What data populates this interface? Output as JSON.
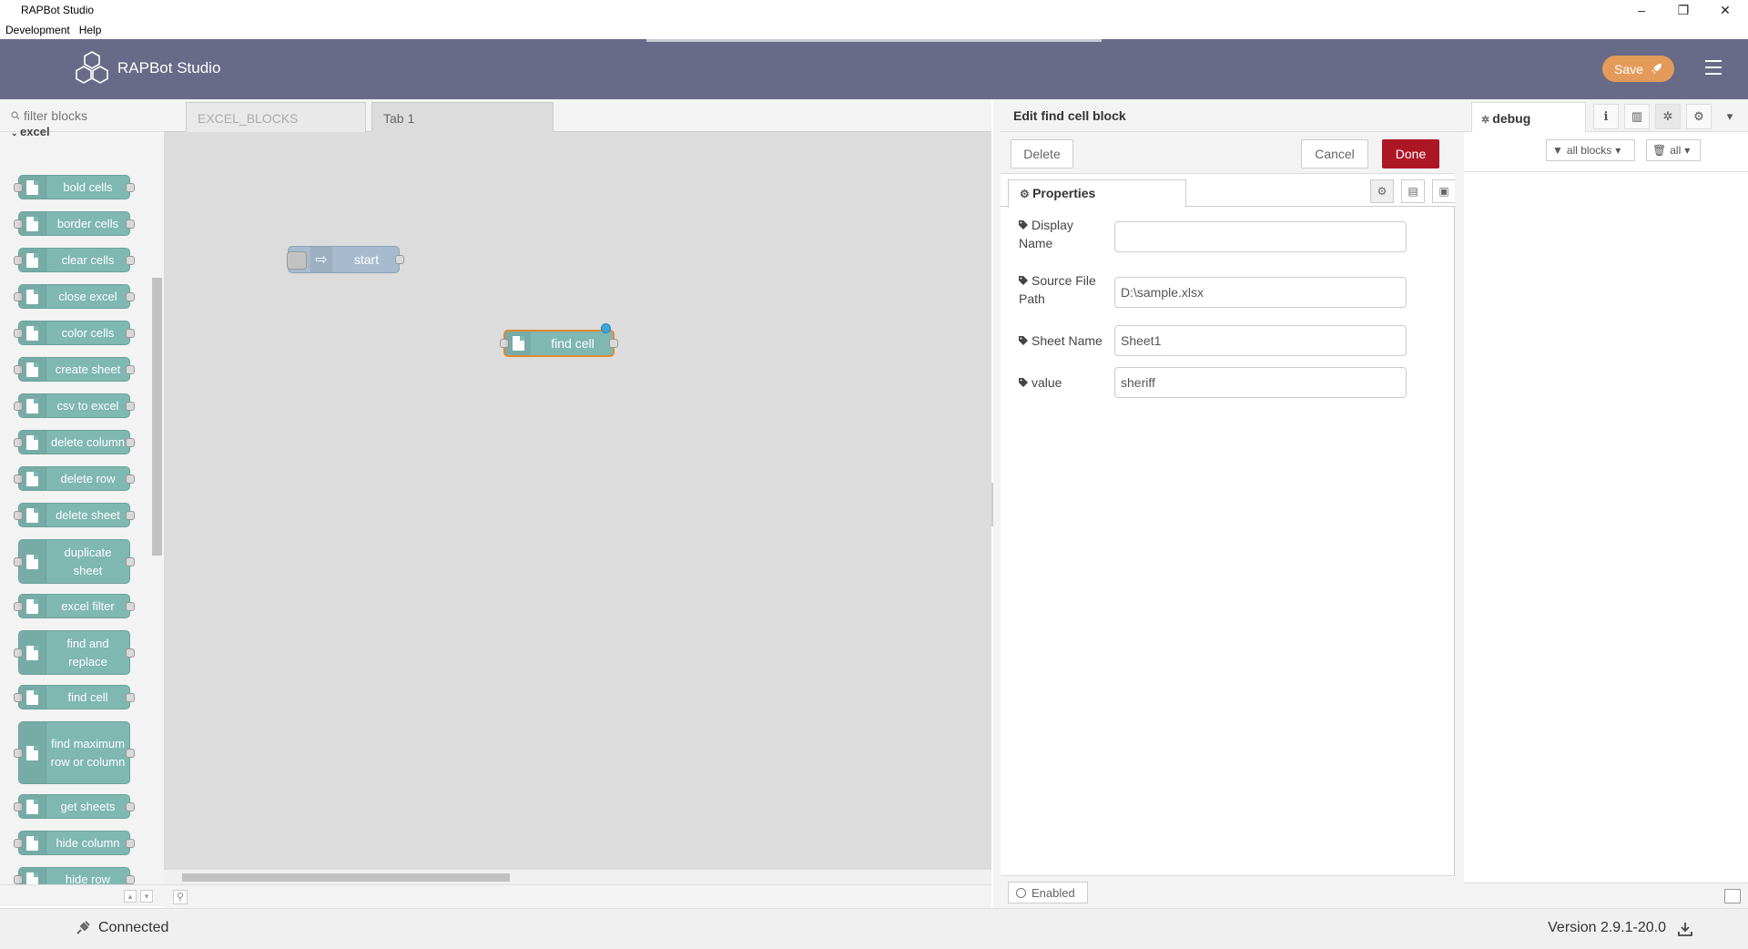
{
  "window": {
    "title": "RAPBot Studio",
    "menus": [
      "Development",
      "Help"
    ],
    "controls": [
      "–",
      "❐",
      "✕"
    ]
  },
  "header": {
    "brand": "RAPBot Studio",
    "deploy_label": "Save",
    "colors": {
      "header_bg": "#686a87",
      "deploy_bg": "#e49b5a"
    }
  },
  "palette": {
    "search_placeholder": "filter blocks",
    "category": "excel",
    "node_color": "#7fb7b1",
    "nodes": [
      {
        "label": "bold cells"
      },
      {
        "label": "border cells"
      },
      {
        "label": "clear cells"
      },
      {
        "label": "close excel"
      },
      {
        "label": "color cells"
      },
      {
        "label": "create sheet"
      },
      {
        "label": "csv to excel"
      },
      {
        "label": "delete column"
      },
      {
        "label": "delete row"
      },
      {
        "label": "delete sheet"
      },
      {
        "label": "duplicate sheet"
      },
      {
        "label": "excel filter"
      },
      {
        "label": "find and replace"
      },
      {
        "label": "find cell"
      },
      {
        "label": "find maximum row or column"
      },
      {
        "label": "get sheets"
      },
      {
        "label": "hide column"
      },
      {
        "label": "hide row"
      }
    ]
  },
  "workspace": {
    "tabs": [
      {
        "label": "EXCEL_BLOCKS",
        "active": false
      },
      {
        "label": "Tab 1",
        "active": true
      }
    ],
    "flow_nodes": [
      {
        "label": "start",
        "type": "inject"
      },
      {
        "label": "find cell",
        "type": "excel",
        "selected": true
      }
    ]
  },
  "editor": {
    "title": "Edit find cell block",
    "delete_label": "Delete",
    "cancel_label": "Cancel",
    "done_label": "Done",
    "tab_label": "Properties",
    "fields": {
      "display_name": {
        "label": "Display Name",
        "value": ""
      },
      "source_file_path": {
        "label": "Source File Path",
        "value": "D:\\sample.xlsx"
      },
      "sheet_name": {
        "label": "Sheet Name",
        "value": "Sheet1"
      },
      "value": {
        "label": "value",
        "value": "sheriff"
      }
    },
    "enabled_label": "Enabled"
  },
  "sidebar": {
    "tab_label": "debug",
    "filter_label": "all blocks",
    "clear_label": "all"
  },
  "status": {
    "connection": "Connected",
    "version": "Version 2.9.1-20.0"
  }
}
